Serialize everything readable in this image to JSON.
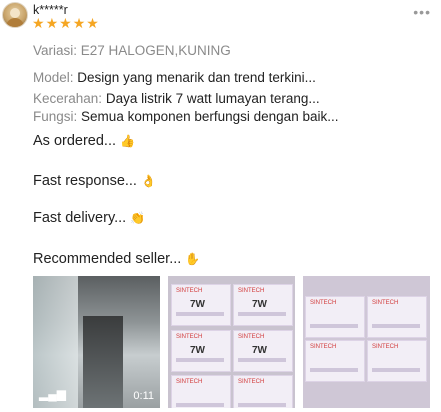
{
  "review": {
    "username": "k*****r",
    "rating": 5,
    "variant": "Variasi: E27 HALOGEN,KUNING",
    "attributes": [
      {
        "key": "Model:",
        "value": "Design yang menarik dan trend terkini..."
      },
      {
        "key": "Kecerahan:",
        "value": "Daya listrik 7 watt lumayan terang..."
      },
      {
        "key": "Fungsi:",
        "value": "Semua komponen berfungsi dengan baik..."
      }
    ],
    "lines": [
      "As ordered...",
      "Fast response...",
      "Fast delivery...",
      "Recommended seller..."
    ]
  },
  "icons": {
    "more": "more-dots-icon",
    "star": "star-icon",
    "video": "video-bars-icon",
    "emojis": [
      "thumbs-up-icon",
      "ok-hand-icon",
      "clap-icon",
      "raised-hand-icon"
    ]
  },
  "media": {
    "video_duration": "0:11",
    "box_brand": "SINTECH",
    "box_watt": "7W"
  },
  "colors": {
    "star": "#f5a623",
    "muted": "#8a8a8a",
    "text": "#222222"
  }
}
